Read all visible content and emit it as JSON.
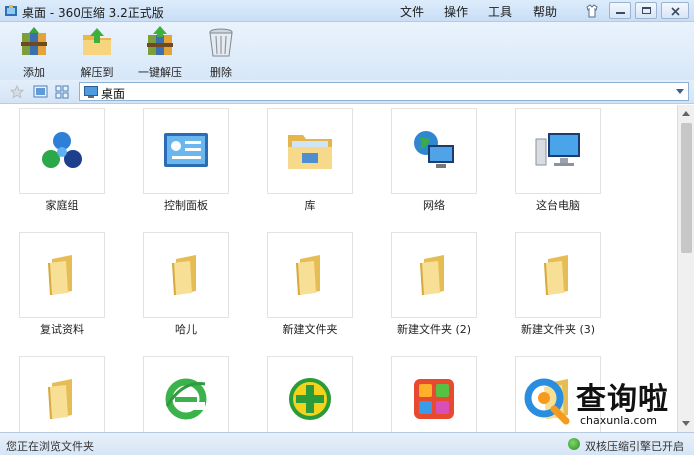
{
  "window": {
    "title": "桌面 - 360压缩 3.2正式版",
    "menus": [
      "文件",
      "操作",
      "工具",
      "帮助"
    ]
  },
  "toolbar": {
    "add_label": "添加",
    "extract_to_label": "解压到",
    "one_click_extract_label": "一键解压",
    "delete_label": "删除"
  },
  "address_bar": {
    "path": "桌面",
    "icon": "desktop-icon"
  },
  "items": [
    {
      "label": "家庭组",
      "icon": "homegroup-icon"
    },
    {
      "label": "控制面板",
      "icon": "control-panel-icon"
    },
    {
      "label": "库",
      "icon": "libraries-icon"
    },
    {
      "label": "网络",
      "icon": "network-icon"
    },
    {
      "label": "这台电脑",
      "icon": "computer-icon"
    },
    {
      "label": "复试资料",
      "icon": "folder-icon"
    },
    {
      "label": "哈儿",
      "icon": "folder-icon"
    },
    {
      "label": "新建文件夹",
      "icon": "folder-icon"
    },
    {
      "label": "新建文件夹 (2)",
      "icon": "folder-icon"
    },
    {
      "label": "新建文件夹 (3)",
      "icon": "folder-icon"
    },
    {
      "label": "",
      "icon": "folder-icon"
    },
    {
      "label": "",
      "icon": "ie-browser-icon"
    },
    {
      "label": "",
      "icon": "360-safe-icon"
    },
    {
      "label": "",
      "icon": "app-store-icon"
    },
    {
      "label": "",
      "icon": "folder-icon"
    }
  ],
  "status": {
    "left": "您正在浏览文件夹",
    "right": "双核压缩引擎已开启"
  },
  "watermark": {
    "big": "查询啦",
    "small": "chaxunla.com"
  },
  "colors": {
    "titlebar": "#c9def5",
    "toolbar": "#d7e7f8",
    "folder": "#f2d77f"
  }
}
